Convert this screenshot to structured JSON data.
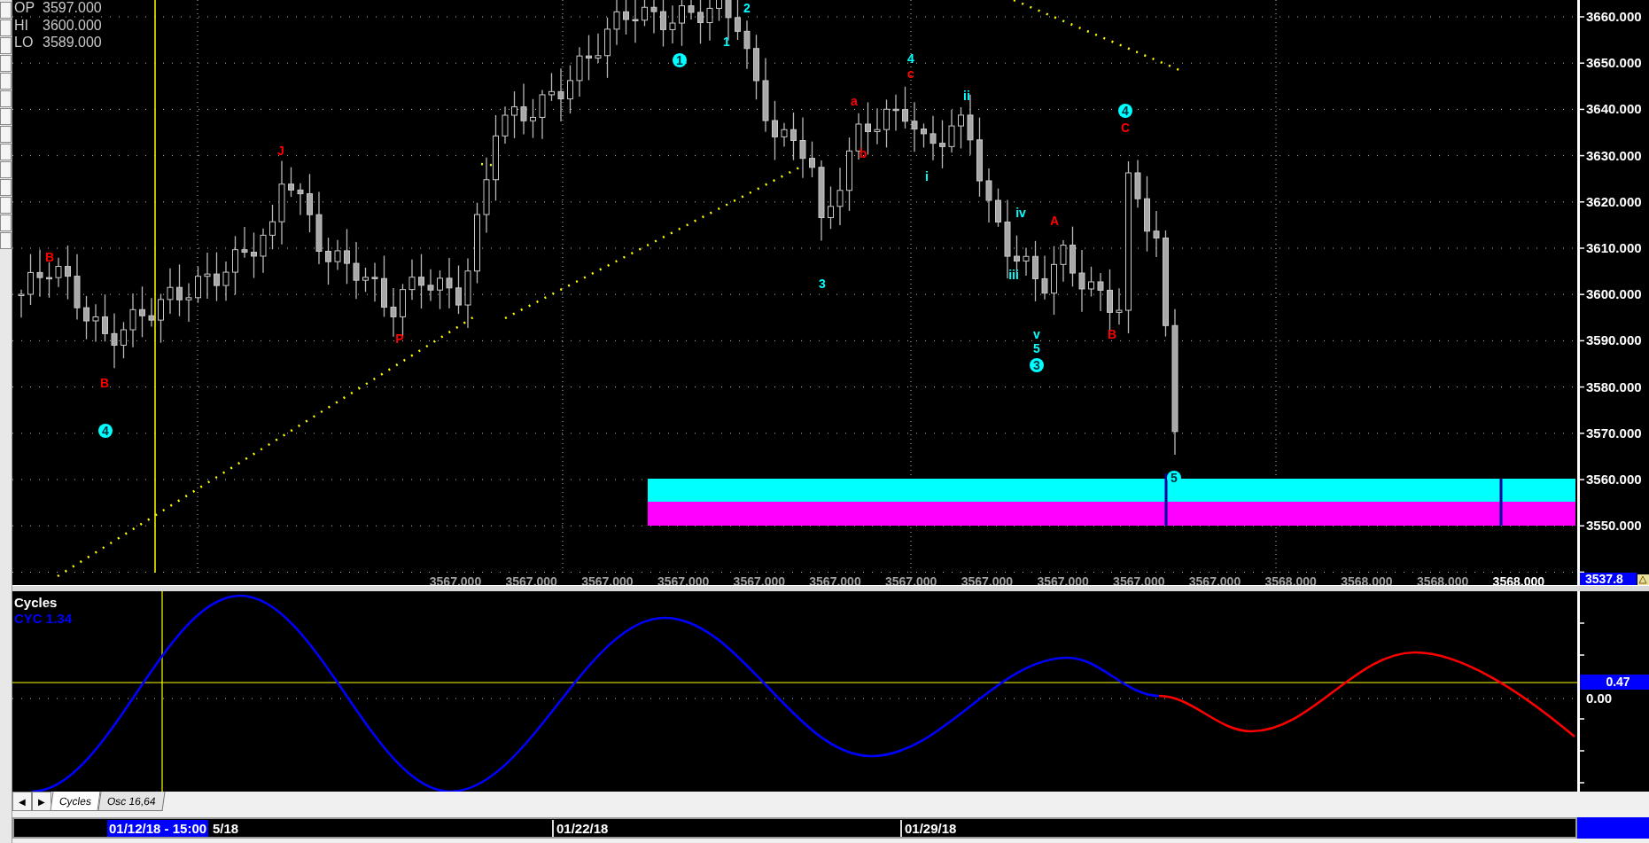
{
  "ohlc": [
    {
      "label": "OP",
      "value": "3597.000"
    },
    {
      "label": "HI",
      "value": "3600.000"
    },
    {
      "label": "LO",
      "value": "3589.000"
    }
  ],
  "wave_labels": [
    {
      "text": "B",
      "color": "#ff0000",
      "circled": false
    },
    {
      "text": "B",
      "color": "#ff0000",
      "circled": false
    },
    {
      "text": "4",
      "color": "#00ffff",
      "circled": true
    },
    {
      "text": "J",
      "color": "#ff0000",
      "circled": false
    },
    {
      "text": "P",
      "color": "#ff0000",
      "circled": false
    },
    {
      "text": "1",
      "color": "#00ffff",
      "circled": true
    },
    {
      "text": "1",
      "color": "#00ffff",
      "circled": false
    },
    {
      "text": "2",
      "color": "#00ffff",
      "circled": false
    },
    {
      "text": "3",
      "color": "#00ffff",
      "circled": false
    },
    {
      "text": "a",
      "color": "#ff0000",
      "circled": false
    },
    {
      "text": "b",
      "color": "#ff0000",
      "circled": false
    },
    {
      "text": "4",
      "color": "#00ffff",
      "circled": false
    },
    {
      "text": "c",
      "color": "#ff0000",
      "circled": false
    },
    {
      "text": "i",
      "color": "#00ffff",
      "circled": false
    },
    {
      "text": "ii",
      "color": "#00ffff",
      "circled": false
    },
    {
      "text": "iii",
      "color": "#00ffff",
      "circled": false
    },
    {
      "text": "iv",
      "color": "#00ffff",
      "circled": false
    },
    {
      "text": "A",
      "color": "#ff0000",
      "circled": false
    },
    {
      "text": "v",
      "color": "#00ffff",
      "circled": false
    },
    {
      "text": "5",
      "color": "#00ffff",
      "circled": false
    },
    {
      "text": "3",
      "color": "#00ffff",
      "circled": true
    },
    {
      "text": "B",
      "color": "#ff0000",
      "circled": false
    },
    {
      "text": "4",
      "color": "#00ffff",
      "circled": true
    },
    {
      "text": "C",
      "color": "#ff0000",
      "circled": false
    },
    {
      "text": "5",
      "color": "#00ffff",
      "circled": true
    }
  ],
  "price_axis": {
    "ticks": [
      "3660.000",
      "3650.000",
      "3640.000",
      "3630.000",
      "3620.000",
      "3610.000",
      "3600.000",
      "3590.000",
      "3580.000",
      "3570.000",
      "3560.000",
      "3550.000"
    ],
    "marker": "3537.8"
  },
  "bottom_values": [
    {
      "text": "3567.000",
      "highlighted": false
    },
    {
      "text": "3567.000",
      "highlighted": false
    },
    {
      "text": "3567.000",
      "highlighted": false
    },
    {
      "text": "3567.000",
      "highlighted": false
    },
    {
      "text": "3567.000",
      "highlighted": false
    },
    {
      "text": "3567.000",
      "highlighted": false
    },
    {
      "text": "3567.000",
      "highlighted": false
    },
    {
      "text": "3567.000",
      "highlighted": false
    },
    {
      "text": "3567.000",
      "highlighted": false
    },
    {
      "text": "3567.000",
      "highlighted": false
    },
    {
      "text": "3567.000",
      "highlighted": false
    },
    {
      "text": "3568.000",
      "highlighted": false
    },
    {
      "text": "3568.000",
      "highlighted": false
    },
    {
      "text": "3568.000",
      "highlighted": false
    },
    {
      "text": "3568.000",
      "highlighted": true
    }
  ],
  "cycles_panel": {
    "title": "Cycles",
    "indicator": "CYC 1.34",
    "marker": "0.47",
    "ticks": [
      "0.00"
    ]
  },
  "nav_buttons": [
    "◀",
    "▶"
  ],
  "tabs": [
    {
      "label": "Cycles",
      "selected": true
    },
    {
      "label": "Osc 16,64",
      "selected": false
    }
  ],
  "date_axis": {
    "cursor": "01/12/18 - 15:00",
    "labels": [
      "5/18",
      "01/22/18",
      "01/29/18"
    ]
  }
}
